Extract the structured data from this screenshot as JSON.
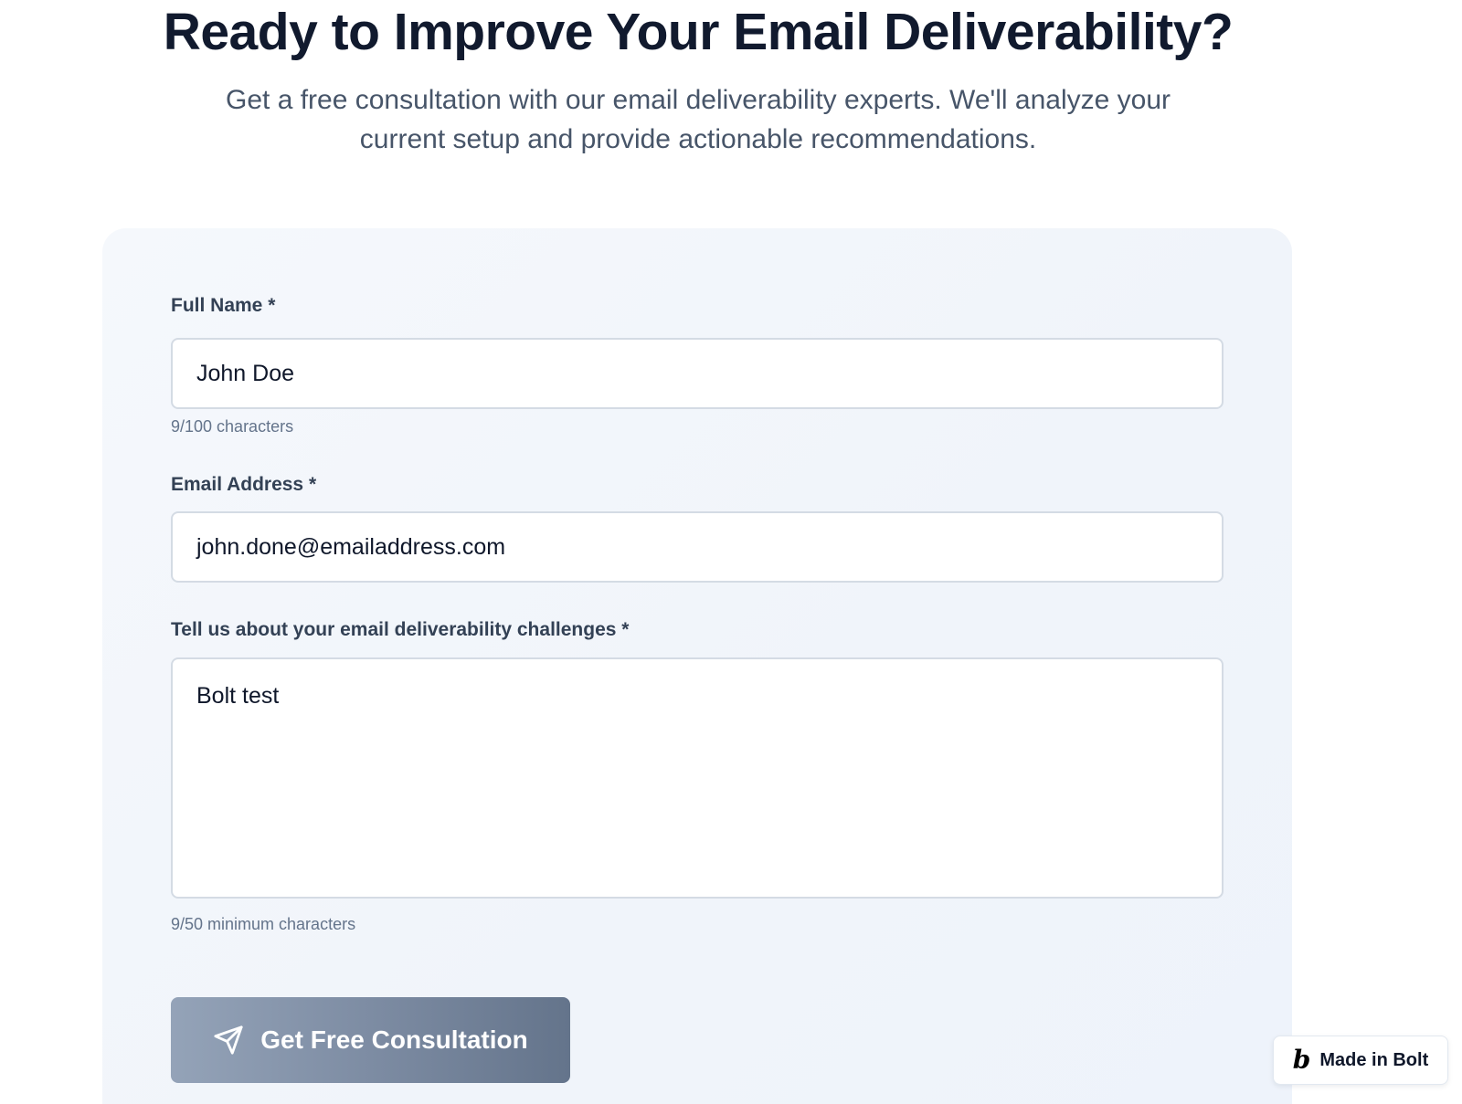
{
  "hero": {
    "title": "Ready to Improve Your Email Deliverability?",
    "subtitle": "Get a free consultation with our email deliverability experts. We'll analyze your current setup and provide actionable recommendations."
  },
  "form": {
    "full_name": {
      "label": "Full Name *",
      "value": "John Doe",
      "helper": "9/100 characters"
    },
    "email": {
      "label": "Email Address *",
      "value": "john.done@emailaddress.com"
    },
    "challenges": {
      "label": "Tell us about your email deliverability challenges *",
      "value": "Bolt test",
      "helper": "9/50 minimum characters"
    },
    "submit": {
      "label": "Get Free Consultation",
      "icon": "send-icon"
    }
  },
  "badge": {
    "logo": "b",
    "label": "Made in Bolt"
  },
  "colors": {
    "heading": "#111a2e",
    "button_start": "#94a3b8",
    "button_end": "#64748b",
    "card_bg": "#f2f6fb"
  }
}
